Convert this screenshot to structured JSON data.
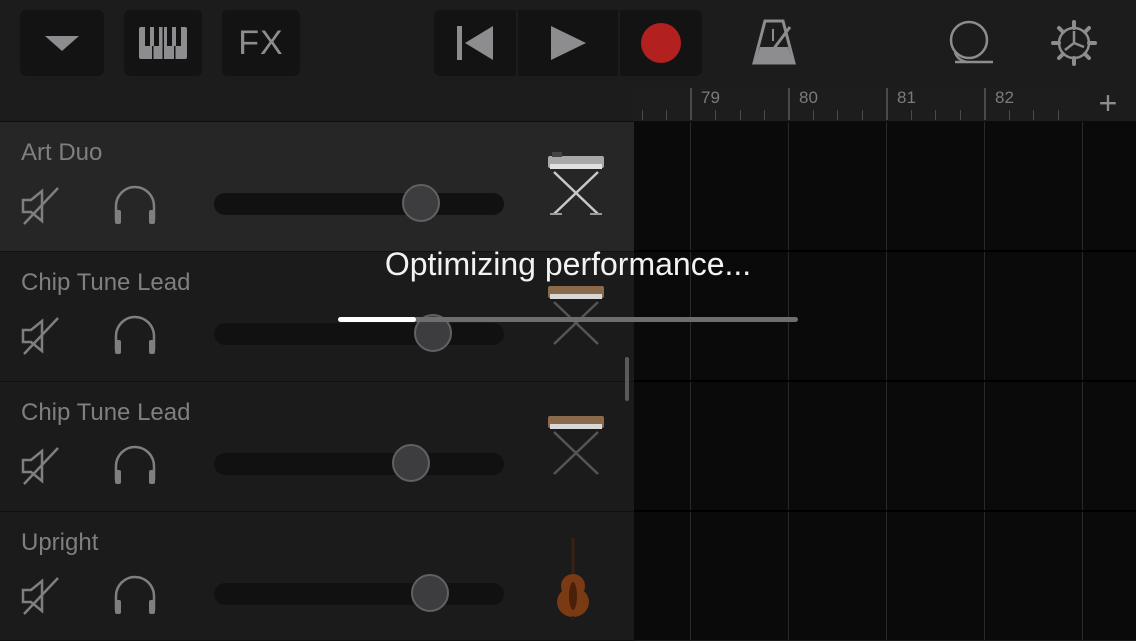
{
  "toolbar": {
    "fx_label": "FX",
    "record_color": "#b32020"
  },
  "ruler": {
    "bars": [
      "79",
      "80",
      "81",
      "82"
    ],
    "add_label": "+"
  },
  "tracks": [
    {
      "name": "Art Duo",
      "instrument": "keyboard-stand-icon",
      "volume": 0.72,
      "selected": true
    },
    {
      "name": "Chip Tune Lead",
      "instrument": "keyboard-stand-icon",
      "volume": 0.76,
      "selected": false
    },
    {
      "name": "Chip Tune Lead",
      "instrument": "keyboard-stand-icon",
      "volume": 0.68,
      "selected": false
    },
    {
      "name": "Upright",
      "instrument": "upright-bass-icon",
      "volume": 0.75,
      "selected": false
    }
  ],
  "overlay": {
    "message": "Optimizing performance...",
    "progress": 0.17
  }
}
